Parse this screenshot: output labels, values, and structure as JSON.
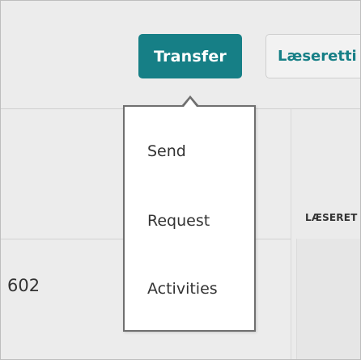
{
  "header": {
    "transfer_label": "Transfer",
    "readonly_label": "Læseretti"
  },
  "dropdown": {
    "items": [
      {
        "label": "Send"
      },
      {
        "label": "Request"
      },
      {
        "label": "Activities"
      }
    ]
  },
  "table": {
    "column_header": "LÆSERET",
    "row_value": "602"
  },
  "colors": {
    "accent": "#167f86",
    "background": "#ececec",
    "menu_border": "#6f6f6f"
  }
}
